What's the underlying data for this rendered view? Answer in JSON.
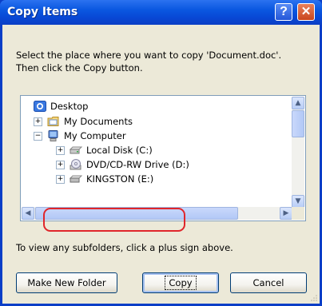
{
  "window": {
    "title": "Copy Items",
    "help_glyph": "?",
    "close_glyph": "✕"
  },
  "instructions": {
    "line1": "Select the place where you want to copy 'Document.doc'.",
    "line2": "Then click the Copy button."
  },
  "tree": {
    "items": [
      {
        "label": "Desktop",
        "icon": "desktop-icon",
        "expander": ""
      },
      {
        "label": "My Documents",
        "icon": "folder-icon",
        "expander": "+"
      },
      {
        "label": "My Computer",
        "icon": "computer-icon",
        "expander": "−"
      },
      {
        "label": "Local Disk (C:)",
        "icon": "hard-drive-icon",
        "expander": "+"
      },
      {
        "label": "DVD/CD-RW Drive (D:)",
        "icon": "dvd-drive-icon",
        "expander": "+"
      },
      {
        "label": "KINGSTON (E:)",
        "icon": "removable-drive-icon",
        "expander": "+"
      }
    ],
    "highlighted_item": "KINGSTON (E:)",
    "highlight_color": "#e0262b"
  },
  "scroll": {
    "up": "▲",
    "down": "▼",
    "left": "◀",
    "right": "▶"
  },
  "hint": "To view any subfolders, click a plus sign above.",
  "buttons": {
    "new_folder": "Make New Folder",
    "copy": "Copy",
    "cancel": "Cancel"
  },
  "colors": {
    "title_bar": "#0a57e0",
    "dialog_background": "#ece9d8"
  }
}
